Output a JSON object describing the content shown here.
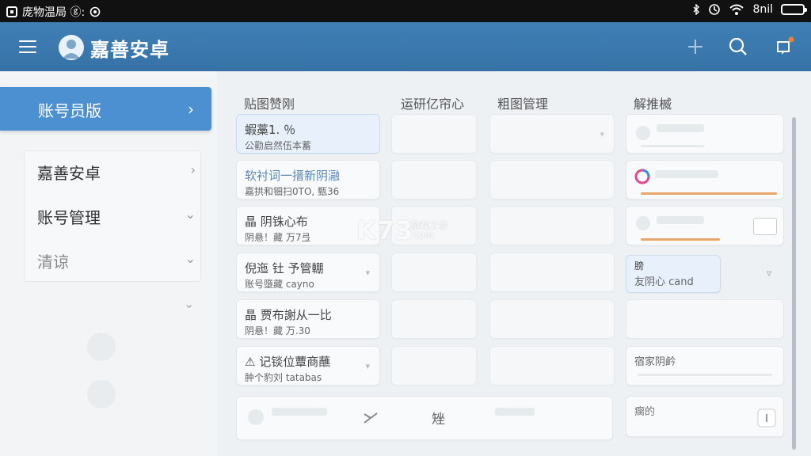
{
  "status_bar": {
    "left_text": "庞物温局 ⓖ:",
    "right_text": "8nil"
  },
  "header": {
    "title": "嘉善安卓"
  },
  "sidebar": {
    "active_item": "账号员版",
    "items": [
      {
        "label": "嘉善安卓"
      },
      {
        "label": "账号管理"
      },
      {
        "label": "清谅"
      }
    ]
  },
  "columns": [
    {
      "title": "贴图赞刚"
    },
    {
      "title": "运研亿帘心"
    },
    {
      "title": "粗图管理"
    },
    {
      "title": "解推楲"
    }
  ],
  "col1_cards": [
    {
      "l1": "蝦藁1. ％",
      "l2": "公勸启然伍本蓄"
    },
    {
      "l1": "软衬词一搢新阴瀜",
      "l2": "嘉拱和钿扫0TO, 甄36"
    },
    {
      "l1": "晶 阴铢心布",
      "l2": "阴悬！藏 万7弖"
    },
    {
      "l1": "倪迤 钍 予管輣",
      "l2": "账号墮藏 cayno"
    },
    {
      "l1": "晶 贾布謝从一比",
      "l2": "阴悬！藏 万.30"
    },
    {
      "l1": "⚠ 记锬位蕈商蘸",
      "l2": "肿个豹刘 tatabas"
    }
  ],
  "col2_cards": [
    {
      "label": "矬"
    }
  ],
  "col4_cards": [
    {
      "l1": "膀",
      "l2": "友阴心 cand"
    },
    {
      "l1": "宿家阴鹶"
    },
    {
      "l1": "瘸的"
    }
  ],
  "watermark": {
    "main": "K73",
    "sub1": "游戏之家",
    "sub2": ".com"
  }
}
